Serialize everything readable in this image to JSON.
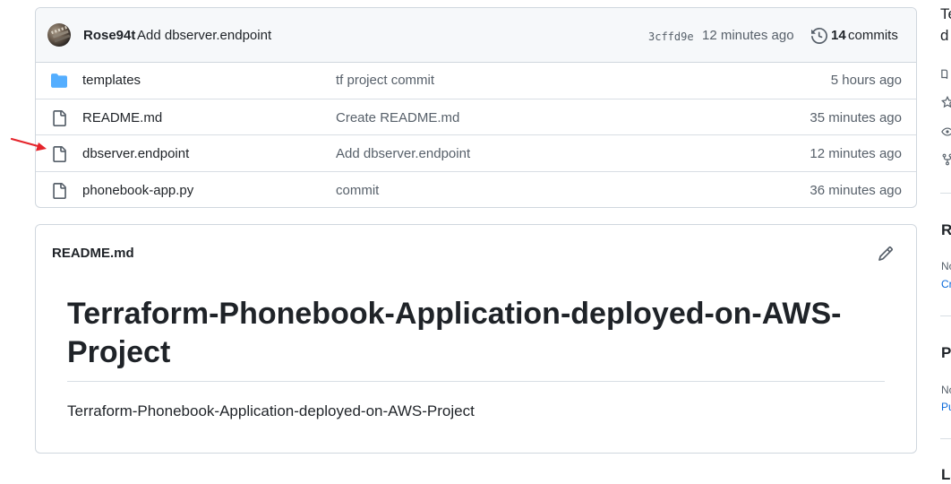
{
  "commit_bar": {
    "author": "Rose94t",
    "message": "Add dbserver.endpoint",
    "sha": "3cffd9e",
    "time": "12 minutes ago",
    "commit_count": "14",
    "commit_label": "commits"
  },
  "files": [
    {
      "name": "templates",
      "type": "folder",
      "message": "tf project commit",
      "time": "5 hours ago"
    },
    {
      "name": "README.md",
      "type": "file",
      "message": "Create README.md",
      "time": "35 minutes ago"
    },
    {
      "name": "dbserver.endpoint",
      "type": "file",
      "message": "Add dbserver.endpoint",
      "time": "12 minutes ago"
    },
    {
      "name": "phonebook-app.py",
      "type": "file",
      "message": "commit",
      "time": "36 minutes ago"
    }
  ],
  "readme": {
    "file_label": "README.md",
    "heading": "Terraform-Phonebook-Application-deployed-on-AWS-Project",
    "paragraph": "Terraform-Phonebook-Application-deployed-on-AWS-Project"
  },
  "sidebar": {
    "about_line1": "Te",
    "about_line2": "d",
    "releases_heading": "R",
    "releases_note": "No",
    "releases_link": "Cr",
    "packages_heading": "Pa",
    "packages_note": "No",
    "packages_link": "Pu",
    "languages_heading": "La"
  },
  "colors": {
    "folder": "#54aeff",
    "annotation_arrow": "#e5242b",
    "link": "#0969da"
  },
  "icons": [
    "history-icon",
    "folder-icon",
    "file-icon",
    "pencil-icon",
    "book-icon",
    "star-icon",
    "eye-icon",
    "fork-icon"
  ]
}
